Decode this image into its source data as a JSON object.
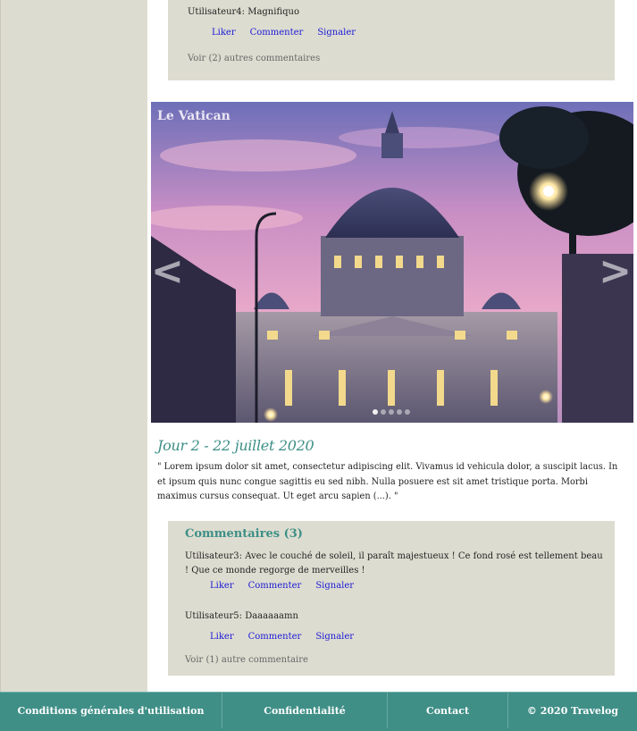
{
  "top_comment": {
    "text": "Utilisateur4: Magnifiquo",
    "actions": [
      "Liker",
      "Commenter",
      "Signaler"
    ],
    "more": "Voir (2) autres commentaires"
  },
  "carousel": {
    "title": "Le Vatican",
    "prev": "<",
    "next": ">",
    "slide_count": 5,
    "active_slide": 1
  },
  "day": {
    "title": "Jour 2 - 22 juillet 2020",
    "text": "\" Lorem ipsum dolor sit amet, consectetur adipiscing elit. Vivamus id vehicula dolor, a suscipit lacus. In et ipsum quis nunc congue sagittis eu sed nibh. Nulla posuere est sit amet tristique porta. Morbi maximus cursus consequat. Ut eget arcu sapien (...). \""
  },
  "comments": {
    "heading": "Commentaires (3)",
    "items": [
      {
        "text": "Utilisateur3: Avec le couché de soleil, il paraît majestueux ! Ce fond rosé est tellement beau ! Que ce monde regorge de merveilles !",
        "actions": [
          "Liker",
          "Commenter",
          "Signaler"
        ]
      },
      {
        "text": "Utilisateur5: Daaaaaamn",
        "actions": [
          "Liker",
          "Commenter",
          "Signaler"
        ]
      }
    ],
    "more": "Voir (1) autre commentaire"
  },
  "footer": {
    "items": [
      "Conditions générales d'utilisation",
      "Confidentialité",
      "Contact",
      "©  2020 Travelog"
    ]
  },
  "colors": {
    "accent": "#3f8f87",
    "box": "#dddcd0",
    "link": "#1a1ad6"
  }
}
